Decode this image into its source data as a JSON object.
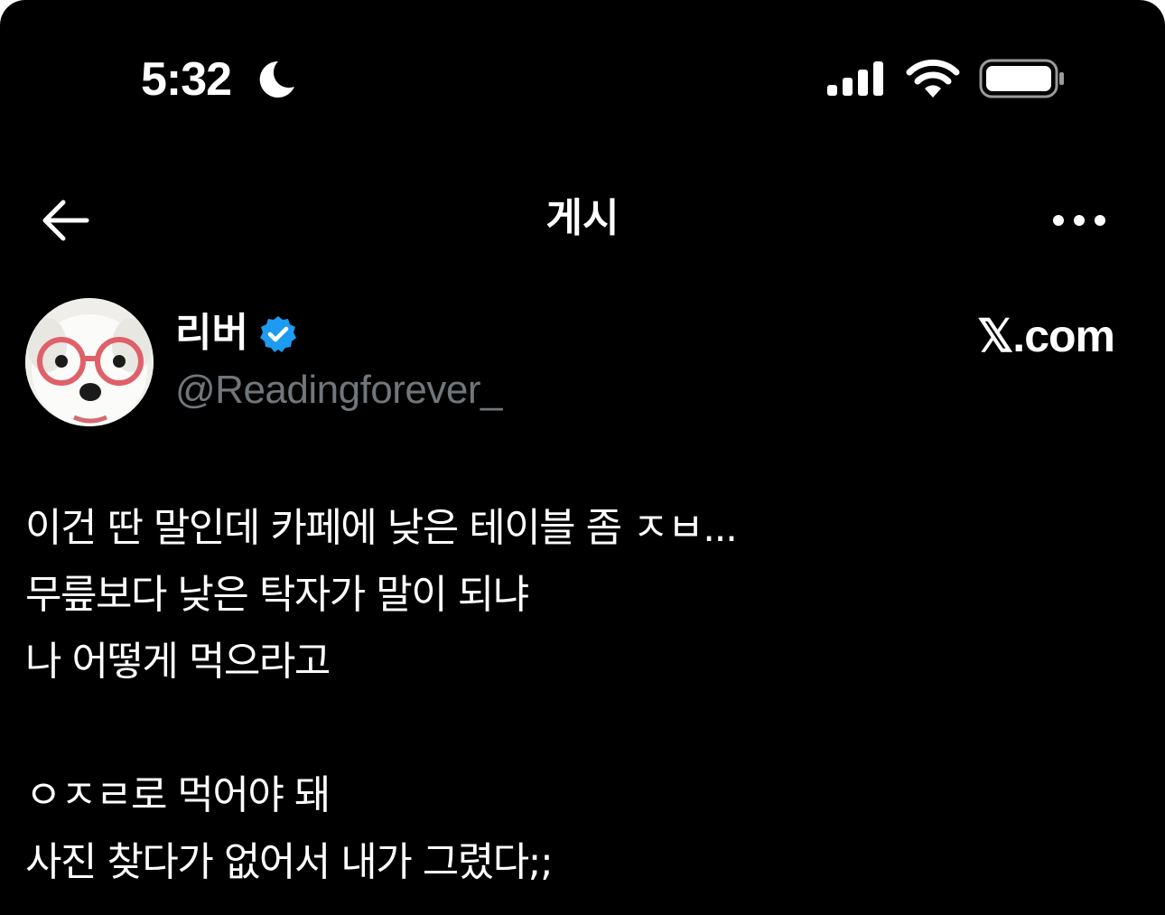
{
  "status_bar": {
    "time": "5:32",
    "icons": [
      "moon-icon",
      "cellular-signal-icon",
      "wifi-icon",
      "battery-icon"
    ]
  },
  "header": {
    "title": "게시",
    "back_icon": "arrow-left-icon",
    "more_icon": "more-horizontal-icon"
  },
  "author": {
    "name": "리버",
    "handle": "@Readingforever_",
    "verified": true,
    "avatar": "white dog wearing red glasses"
  },
  "source": "𝕏.com",
  "post": {
    "paragraphs": [
      [
        "이건 딴 말인데 카페에 낮은 테이블 좀 ㅈㅂ...",
        "무릎보다 낮은 탁자가 말이 되냐",
        "나 어떻게 먹으라고"
      ],
      [
        "ㅇㅈㄹ로 먹어야 돼",
        "사진 찾다가 없어서 내가 그렸다;;"
      ]
    ]
  },
  "colors": {
    "background": "#000000",
    "text": "#ffffff",
    "secondary_text": "#71767b",
    "verified_badge": "#1d9bf0"
  }
}
